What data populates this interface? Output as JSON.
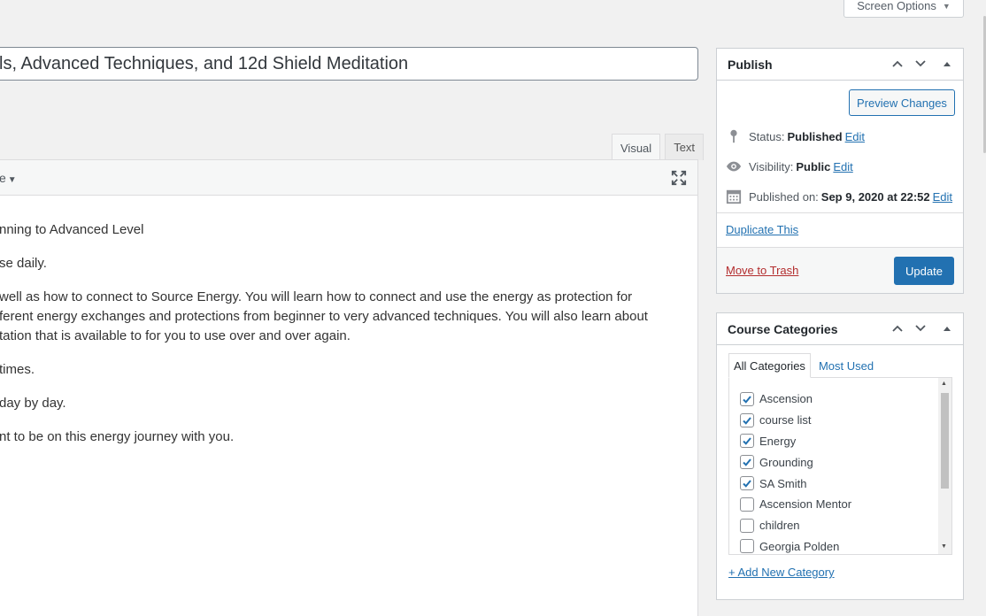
{
  "screen_options": {
    "label": "Screen Options",
    "caret": "▼"
  },
  "post": {
    "title": "ls, Advanced Techniques, and 12d Shield Meditation"
  },
  "editor": {
    "tabs": [
      {
        "label": "Visual",
        "active": true
      },
      {
        "label": "Text",
        "active": false
      }
    ],
    "format_dropdown": "e",
    "format_caret": "▼",
    "paragraphs": [
      "nning to Advanced Level",
      "se daily.",
      "well as how to connect to Source Energy. You will learn how to connect and use the energy as protection for",
      "ferent energy exchanges and protections from beginner to very advanced techniques. You will also learn about",
      "tation that is available to for you to use over and over again.",
      "times.",
      "day by day.",
      "nt to be on this energy journey with you."
    ]
  },
  "publish": {
    "title": "Publish",
    "preview_label": "Preview Changes",
    "status_label": "Status:",
    "status_value": "Published",
    "visibility_label": "Visibility:",
    "visibility_value": "Public",
    "published_label": "Published on:",
    "published_value": "Sep 9, 2020 at 22:52",
    "edit_label": "Edit",
    "duplicate_label": "Duplicate This",
    "trash_label": "Move to Trash",
    "update_label": "Update"
  },
  "categories": {
    "title": "Course Categories",
    "tab_all": "All Categories",
    "tab_most_used": "Most Used",
    "add_new": "+ Add New Category",
    "items": [
      {
        "label": "Ascension",
        "checked": true
      },
      {
        "label": "course list",
        "checked": true
      },
      {
        "label": "Energy",
        "checked": true
      },
      {
        "label": "Grounding",
        "checked": true
      },
      {
        "label": "SA Smith",
        "checked": true
      },
      {
        "label": "Ascension Mentor",
        "checked": false
      },
      {
        "label": "children",
        "checked": false
      },
      {
        "label": "Georgia Polden",
        "checked": false
      }
    ]
  },
  "colors": {
    "accent": "#2271b1",
    "danger": "#b32d2e"
  }
}
